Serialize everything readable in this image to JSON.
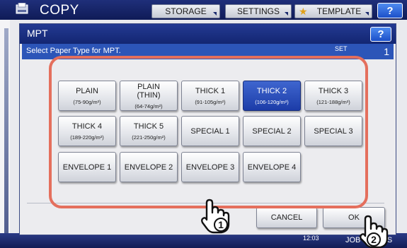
{
  "app": {
    "title": "COPY",
    "tabs": [
      {
        "label": "STORAGE"
      },
      {
        "label": "SETTINGS"
      },
      {
        "label": "TEMPLATE"
      }
    ],
    "help_label": "?"
  },
  "status": {
    "time": "12:03",
    "job_label": "JOB STATUS"
  },
  "dialog": {
    "title": "MPT",
    "help_label": "?",
    "subtitle": "Select Paper Type for MPT.",
    "set_label": "SET",
    "set_value": "1",
    "paper_types": [
      {
        "label": "PLAIN",
        "range": "(75-90g/m²)",
        "selected": false
      },
      {
        "label": "PLAIN\n(THIN)",
        "range": "(64-74g/m²)",
        "selected": false
      },
      {
        "label": "THICK 1",
        "range": "(91-105g/m²)",
        "selected": false
      },
      {
        "label": "THICK 2",
        "range": "(106-120g/m²)",
        "selected": true
      },
      {
        "label": "THICK 3",
        "range": "(121-188g/m²)",
        "selected": false
      },
      {
        "label": "THICK 4",
        "range": "(189-220g/m²)",
        "selected": false
      },
      {
        "label": "THICK 5",
        "range": "(221-250g/m²)",
        "selected": false
      },
      {
        "label": "SPECIAL 1",
        "range": "",
        "selected": false
      },
      {
        "label": "SPECIAL 2",
        "range": "",
        "selected": false
      },
      {
        "label": "SPECIAL 3",
        "range": "",
        "selected": false
      },
      {
        "label": "ENVELOPE 1",
        "range": "",
        "selected": false
      },
      {
        "label": "ENVELOPE 2",
        "range": "",
        "selected": false
      },
      {
        "label": "ENVELOPE 3",
        "range": "",
        "selected": false
      },
      {
        "label": "ENVELOPE 4",
        "range": "",
        "selected": false
      }
    ],
    "cancel_label": "CANCEL",
    "ok_label": "OK"
  },
  "callouts": {
    "step1": "1",
    "step2": "2",
    "color": "#e46f5d"
  },
  "colors": {
    "titlebar": "#1b2f86",
    "selected": "#2a4fc0",
    "highlight": "#e46f5d"
  }
}
